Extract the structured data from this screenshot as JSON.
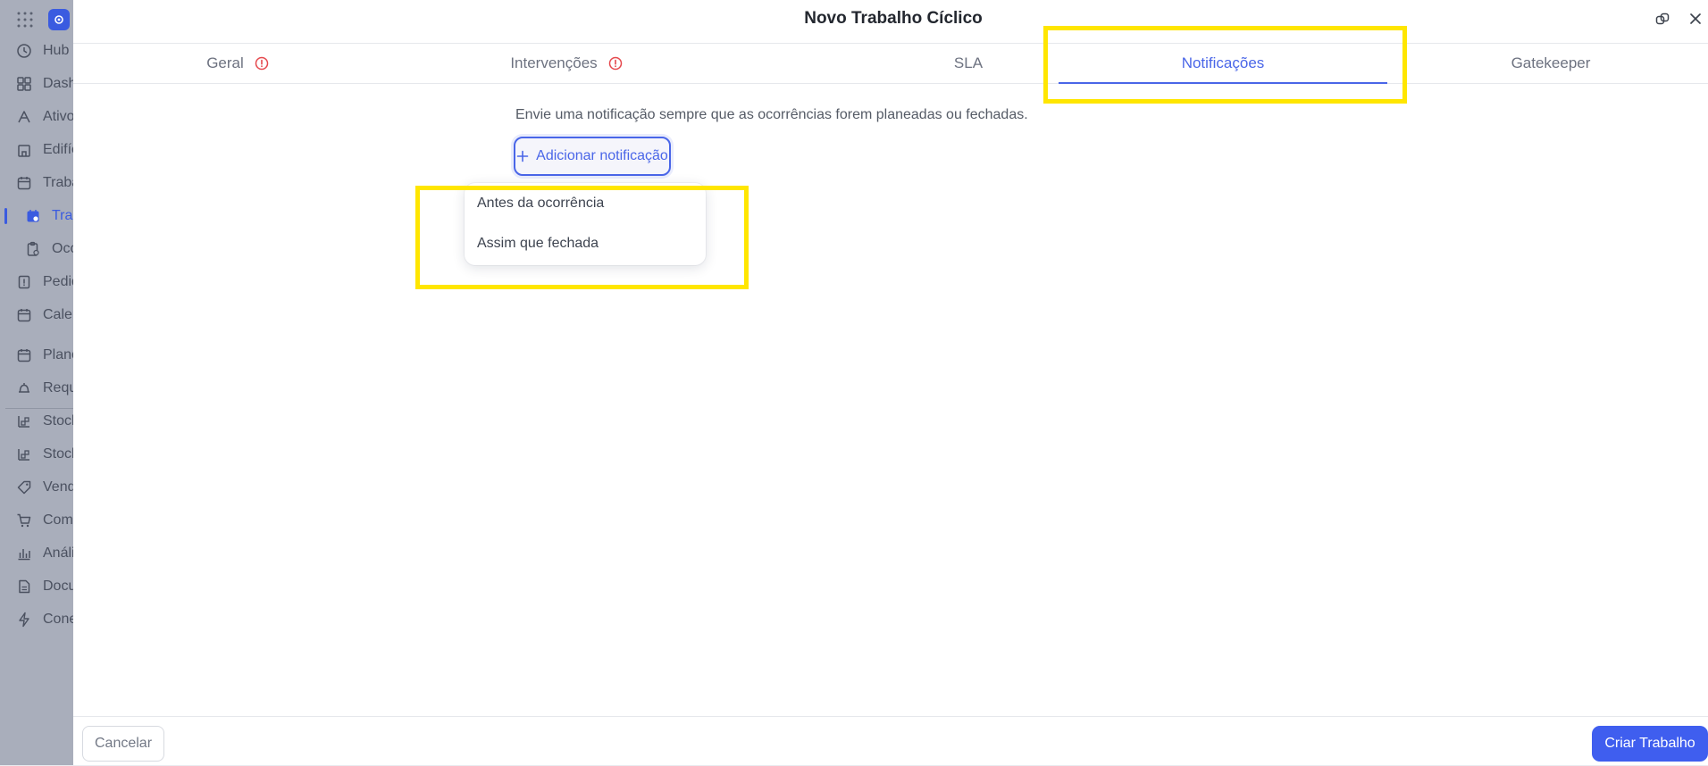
{
  "sidebar": {
    "items": [
      {
        "label": "Hub",
        "icon": "hub-icon",
        "sub": false,
        "active": false
      },
      {
        "label": "Dashboards",
        "icon": "dashboard-icon",
        "sub": false,
        "active": false
      },
      {
        "label": "Ativos",
        "icon": "asset-icon",
        "sub": false,
        "active": false
      },
      {
        "label": "Edifícios",
        "icon": "building-icon",
        "sub": false,
        "active": false
      },
      {
        "label": "Trabalhos",
        "icon": "calendar-icon",
        "sub": false,
        "active": false
      },
      {
        "label": "Trabalhos Cíclicos",
        "icon": "calendar-cycle-icon",
        "sub": true,
        "active": true
      },
      {
        "label": "Ocorrências",
        "icon": "clipboard-icon",
        "sub": true,
        "active": false
      },
      {
        "label": "Pedidos",
        "icon": "request-icon",
        "sub": false,
        "active": false
      },
      {
        "label": "Calendário",
        "icon": "calendar-icon",
        "sub": false,
        "active": false
      },
      {
        "label": "Planos",
        "icon": "calendar-icon",
        "sub": false,
        "active": false
      },
      {
        "label": "Requisições",
        "icon": "bell-icon",
        "sub": false,
        "active": false
      },
      {
        "label": "Stock",
        "icon": "stock-icon",
        "sub": false,
        "active": false
      },
      {
        "label": "Stock",
        "icon": "stock-icon",
        "sub": false,
        "active": false
      },
      {
        "label": "Vendas",
        "icon": "tag-icon",
        "sub": false,
        "active": false
      },
      {
        "label": "Compras",
        "icon": "cart-icon",
        "sub": false,
        "active": false
      },
      {
        "label": "Análises",
        "icon": "chart-icon",
        "sub": false,
        "active": false
      },
      {
        "label": "Documentos",
        "icon": "document-icon",
        "sub": false,
        "active": false
      },
      {
        "label": "Conexões",
        "icon": "bolt-icon",
        "sub": false,
        "active": false
      }
    ]
  },
  "modal": {
    "title": "Novo Trabalho Cíclico",
    "tabs": [
      {
        "label": "Geral",
        "warning": true,
        "active": false
      },
      {
        "label": "Intervenções",
        "warning": true,
        "active": false
      },
      {
        "label": "SLA",
        "warning": false,
        "active": false
      },
      {
        "label": "Notificações",
        "warning": false,
        "active": true
      },
      {
        "label": "Gatekeeper",
        "warning": false,
        "active": false
      }
    ],
    "description": "Envie uma notificação sempre que as ocorrências forem planeadas ou fechadas.",
    "add_button_label": "Adicionar notificação",
    "dropdown_options": [
      "Antes da ocorrência",
      "Assim que fechada"
    ],
    "cancel_label": "Cancelar",
    "create_label": "Criar Trabalho"
  },
  "colors": {
    "accent": "#4a66e8",
    "primary_button": "#3f5eef",
    "warning": "#e5484d",
    "highlight": "#ffe600",
    "sidebar_overlay": "#a9aebb"
  }
}
